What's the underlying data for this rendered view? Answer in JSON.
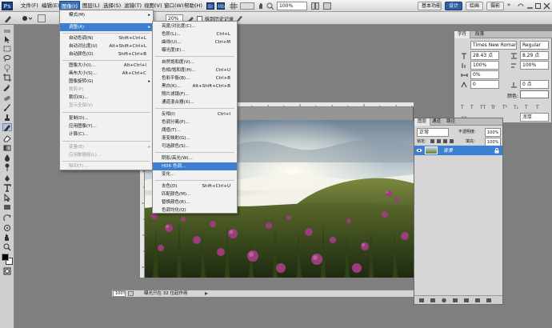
{
  "app": {
    "logo": "Ps"
  },
  "menubar": {
    "items": [
      "文件(F)",
      "编辑(E)",
      "图像(I)",
      "图层(L)",
      "选择(S)",
      "滤镜(T)",
      "视图(V)",
      "窗口(W)",
      "帮助(H)"
    ],
    "active_index": 2,
    "zoom": "100%",
    "workspace_buttons": [
      "基本功能",
      "设计",
      "绘画",
      "摄影"
    ],
    "workspace_selected": 1,
    "more": "»"
  },
  "options": {
    "opacity_value": "20%",
    "history_checkbox_label": "抹到历史记录"
  },
  "image_menu": {
    "items": [
      {
        "label": "模式(M)",
        "shortcut": "",
        "submenu": true,
        "disabled": false
      },
      {
        "label": "调整(A)",
        "shortcut": "",
        "submenu": true,
        "disabled": false,
        "highlight": true
      },
      {
        "label": "自动色调(N)",
        "shortcut": "Shift+Ctrl+L",
        "disabled": false
      },
      {
        "label": "自动对比度(U)",
        "shortcut": "Alt+Shift+Ctrl+L",
        "disabled": false
      },
      {
        "label": "自动颜色(O)",
        "shortcut": "Shift+Ctrl+B",
        "disabled": false
      },
      {
        "label": "图像大小(I)...",
        "shortcut": "Alt+Ctrl+I",
        "disabled": false
      },
      {
        "label": "画布大小(S)...",
        "shortcut": "Alt+Ctrl+C",
        "disabled": false
      },
      {
        "label": "图像旋转(G)",
        "shortcut": "",
        "submenu": true,
        "disabled": false
      },
      {
        "label": "裁剪(P)",
        "shortcut": "",
        "disabled": true
      },
      {
        "label": "裁切(R)...",
        "shortcut": "",
        "disabled": false
      },
      {
        "label": "显示全部(V)",
        "shortcut": "",
        "disabled": true
      },
      {
        "label": "复制(D)...",
        "shortcut": "",
        "disabled": false
      },
      {
        "label": "应用图像(Y)...",
        "shortcut": "",
        "disabled": false
      },
      {
        "label": "计算(C)...",
        "shortcut": "",
        "disabled": false
      },
      {
        "label": "变量(B)",
        "shortcut": "",
        "submenu": true,
        "disabled": true
      },
      {
        "label": "应用数据组(L)...",
        "shortcut": "",
        "disabled": true
      },
      {
        "label": "陷印(T)...",
        "shortcut": "",
        "disabled": true
      }
    ]
  },
  "adjust_menu": {
    "items": [
      {
        "label": "亮度/对比度(C)...",
        "shortcut": ""
      },
      {
        "label": "色阶(L)...",
        "shortcut": "Ctrl+L"
      },
      {
        "label": "曲线(U)...",
        "shortcut": "Ctrl+M"
      },
      {
        "label": "曝光度(E)...",
        "shortcut": ""
      },
      {
        "label": "自然饱和度(V)...",
        "shortcut": ""
      },
      {
        "label": "色相/饱和度(H)...",
        "shortcut": "Ctrl+U"
      },
      {
        "label": "色彩平衡(B)...",
        "shortcut": "Ctrl+B"
      },
      {
        "label": "黑白(K)...",
        "shortcut": "Alt+Shift+Ctrl+B"
      },
      {
        "label": "照片滤镜(F)...",
        "shortcut": ""
      },
      {
        "label": "通道混合器(X)...",
        "shortcut": ""
      },
      {
        "label": "反相(I)",
        "shortcut": "Ctrl+I"
      },
      {
        "label": "色调分离(P)...",
        "shortcut": ""
      },
      {
        "label": "阈值(T)...",
        "shortcut": ""
      },
      {
        "label": "渐变映射(G)...",
        "shortcut": ""
      },
      {
        "label": "可选颜色(S)...",
        "shortcut": ""
      },
      {
        "label": "阴影/高光(W)...",
        "shortcut": ""
      },
      {
        "label": "HDR 色调...",
        "shortcut": "",
        "highlight": true
      },
      {
        "label": "变化...",
        "shortcut": ""
      },
      {
        "label": "去色(D)",
        "shortcut": "Shift+Ctrl+U"
      },
      {
        "label": "匹配颜色(M)...",
        "shortcut": ""
      },
      {
        "label": "替换颜色(R)...",
        "shortcut": ""
      },
      {
        "label": "色调均化(Q)",
        "shortcut": ""
      }
    ]
  },
  "character_panel": {
    "tabs": [
      "字符",
      "段落"
    ],
    "font_family": "Times New Roman",
    "font_style": "Regular",
    "font_size": "28.43 点",
    "leading": "8.29 点",
    "scale_v": "100%",
    "scale_h": "100%",
    "tracking": "0%",
    "kerning": "0",
    "baseline": "0 点",
    "color_label": "颜色:",
    "antialias": "浑厚"
  },
  "layers_panel": {
    "tabs": [
      "图层",
      "通道",
      "路径"
    ],
    "blend_mode": "正常",
    "opacity_label": "不透明度:",
    "opacity": "100%",
    "lock_label": "锁定:",
    "fill_label": "填充:",
    "fill": "100%",
    "layer_name": "背景"
  },
  "status": {
    "zoom": "100%",
    "info": "曝光只在 32 位起作用"
  }
}
